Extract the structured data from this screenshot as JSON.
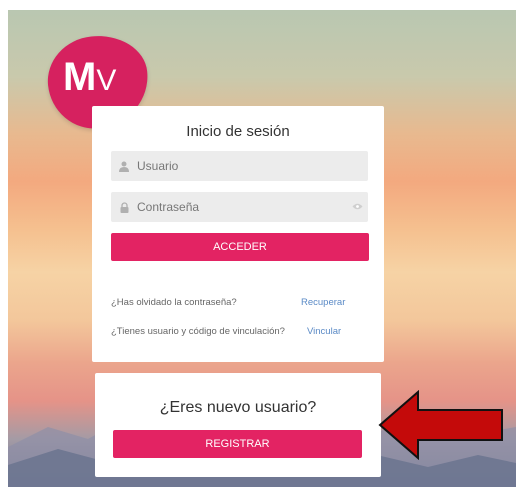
{
  "logo": {
    "main": "M",
    "small": "V"
  },
  "login": {
    "title": "Inicio de sesión",
    "username_placeholder": "Usuario",
    "password_placeholder": "Contraseña",
    "submit_label": "ACCEDER",
    "forgot_text": "¿Has olvidado la contraseña?",
    "recover_link": "Recuperar",
    "link_text": "¿Tienes usuario y código de vinculación?",
    "link_action": "Vincular"
  },
  "new_user": {
    "title": "¿Eres nuevo usuario?",
    "register_label": "REGISTRAR"
  },
  "colors": {
    "accent": "#e32363",
    "arrow": "#c40a0a",
    "link": "#5a8ac6"
  },
  "icons": [
    "user-icon",
    "lock-icon",
    "eye-icon",
    "arrow-pointer-icon"
  ]
}
